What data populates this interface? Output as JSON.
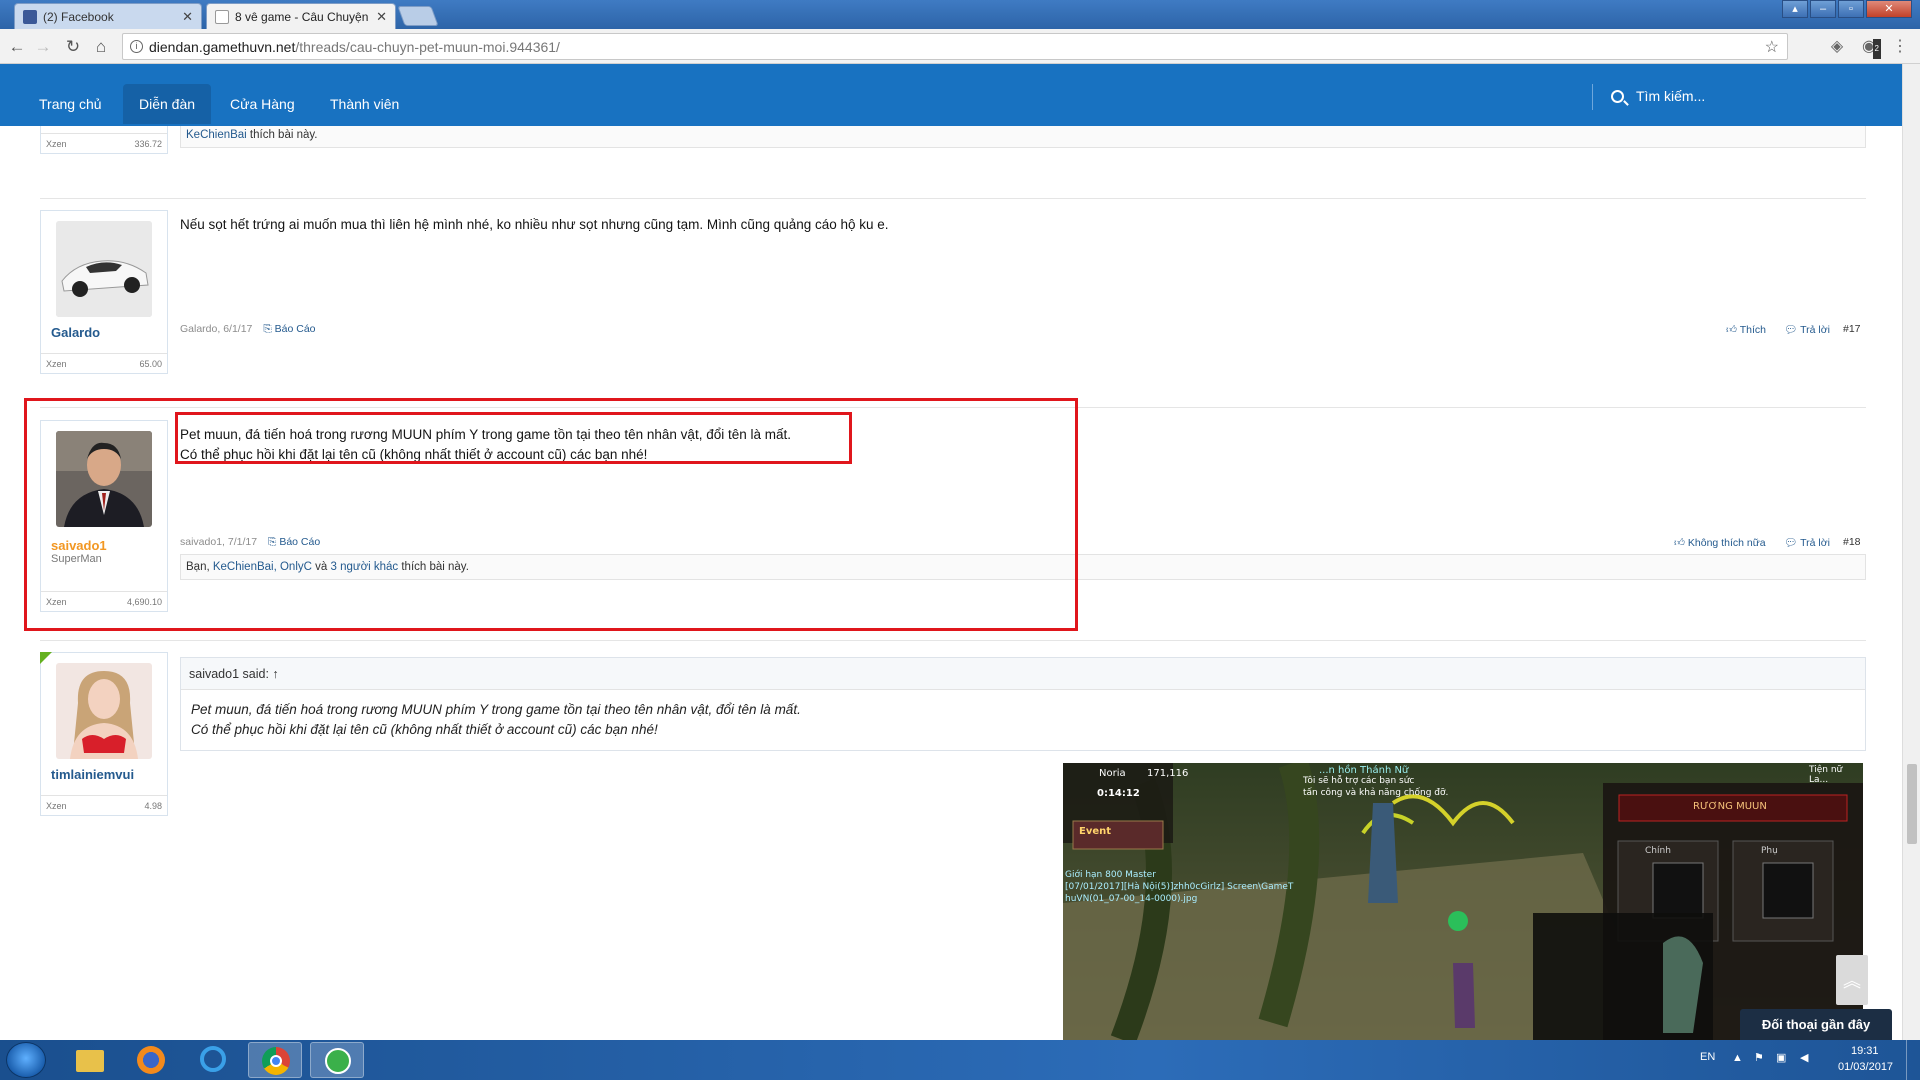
{
  "browser": {
    "tabs": [
      {
        "title": "(2) Facebook",
        "icon": "facebook-icon",
        "active": false
      },
      {
        "title": "8 vê game - Câu Chuyện",
        "icon": "page-icon",
        "active": true
      }
    ],
    "url_host": "diendan.gamethuvn.net",
    "url_path": "/threads/cau-chuyn-pet-muun-moi.944361/",
    "ext_badge": "2"
  },
  "site_nav": {
    "items": [
      "Trang chủ",
      "Diễn đàn",
      "Cửa Hàng",
      "Thành viên"
    ],
    "active": "Diễn đàn",
    "search_placeholder": "Tìm kiếm..."
  },
  "posts": [
    {
      "likes_prefix": "",
      "likes_names": "KeChienBai",
      "likes_suffix": " thích bài này.",
      "xzen_label": "Xzen",
      "xzen_value": "336.72"
    },
    {
      "author": "Galardo",
      "message": "Nếu sọt hết trứng ai muốn mua thì liên hệ mình nhé, ko nhiều như sọt nhưng cũng tạm. Mình cũng quảng cáo hộ ku e.",
      "meta": "Galardo, 6/1/17",
      "report": "Báo Cáo",
      "like_label": "Thích",
      "reply_label": "Trả lời",
      "number": "#17",
      "xzen_label": "Xzen",
      "xzen_value": "65.00"
    },
    {
      "author": "saivado1",
      "user_title": "SuperMan",
      "message_line1": "Pet muun, đá tiến hoá trong rương MUUN phím Y trong game tồn tại theo tên nhân vật, đổi tên là mất.",
      "message_line2": "Có thể phục hồi khi đặt lại tên cũ (không nhất thiết ở account cũ) các bạn nhé!",
      "meta": "saivado1, 7/1/17",
      "report": "Báo Cáo",
      "like_label": "Không thích nữa",
      "reply_label": "Trả lời",
      "number": "#18",
      "likes_prefix": "Bạn, ",
      "likes_names": "KeChienBai, OnlyC",
      "likes_mid": " và ",
      "likes_others": "3 người khác",
      "likes_suffix": " thích bài này.",
      "xzen_label": "Xzen",
      "xzen_value": "4,690.10"
    },
    {
      "author": "timlainiemvui",
      "quote_header": "saivado1 said: ↑",
      "quote_line1": "Pet muun, đá tiến hoá trong rương MUUN phím Y trong game tồn tại theo tên nhân vật, đổi tên là mất.",
      "quote_line2": "Có thể phục hồi khi đặt lại tên cũ (không nhất thiết ở account cũ) các bạn nhé!",
      "xzen_label": "Xzen",
      "xzen_value": "4.98"
    }
  ],
  "game_screenshot": {
    "server": "Noria",
    "coords": "171,116",
    "timer": "0:14:12",
    "event_label": "Event",
    "npc_title": "...n hồn Thánh Nữ",
    "npc_line1": "Tôi sẽ hỗ trợ các bạn sức",
    "npc_line2": "tấn công và khả năng chống đỡ.",
    "corner_name": "Tiện nữ La...",
    "info_line1": "Giới hạn 800 Master",
    "info_line2": "[07/01/2017][Hà Nội(5)]zhh0cGirlz] Screen\\GameT",
    "info_line3": "huVN(01_07-00_14-0000).jpg",
    "panel_title": "RƯƠNG MUUN",
    "tab_main": "Chính",
    "tab_sub": "Phụ"
  },
  "widgets": {
    "recent_chats": "Đối thoại gần đây"
  },
  "taskbar": {
    "lang": "EN",
    "time": "19:31",
    "date": "01/03/2017"
  }
}
